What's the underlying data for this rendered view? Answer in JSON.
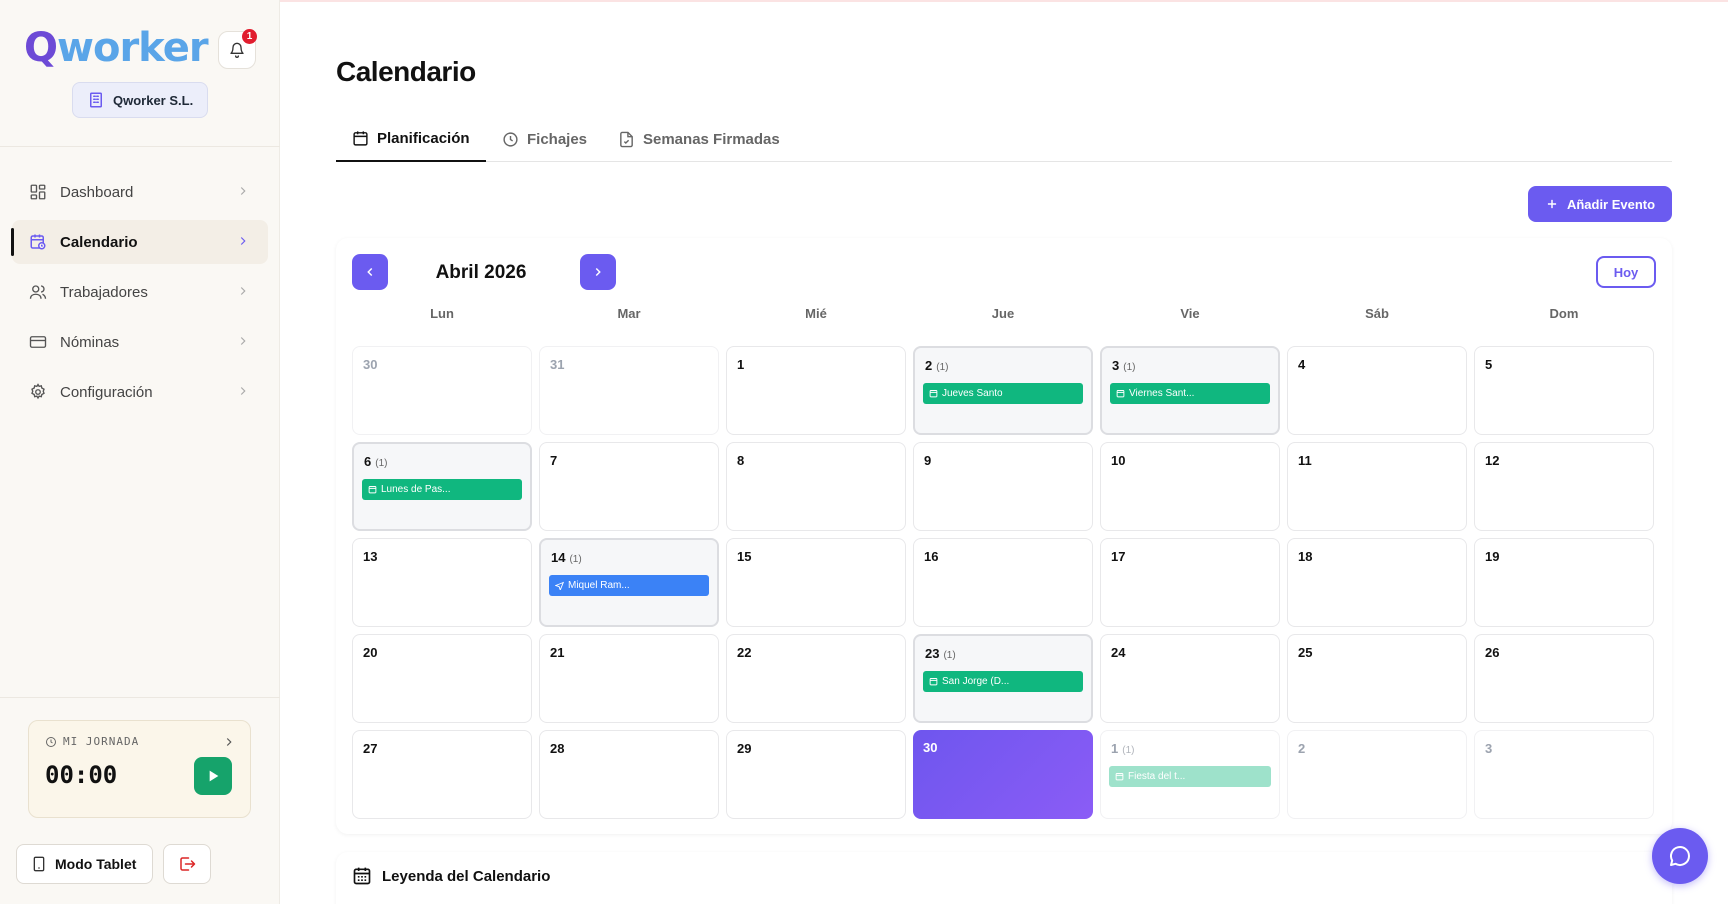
{
  "app": {
    "logo_q": "Q",
    "logo_rest": "worker",
    "notifications_count": "1",
    "company": "Qworker S.L."
  },
  "sidebar": {
    "items": [
      {
        "label": "Dashboard",
        "icon": "dashboard-icon",
        "active": false
      },
      {
        "label": "Calendario",
        "icon": "calendar-clock-icon",
        "active": true
      },
      {
        "label": "Trabajadores",
        "icon": "users-icon",
        "active": false
      },
      {
        "label": "Nóminas",
        "icon": "credit-card-icon",
        "active": false
      },
      {
        "label": "Configuración",
        "icon": "gear-icon",
        "active": false
      }
    ],
    "jornada_label": "MI JORNADA",
    "jornada_time": "00:00",
    "tablet_label": "Modo Tablet"
  },
  "page": {
    "title": "Calendario",
    "tabs": [
      {
        "label": "Planificación",
        "icon": "calendar-icon",
        "active": true
      },
      {
        "label": "Fichajes",
        "icon": "clock-icon",
        "active": false
      },
      {
        "label": "Semanas Firmadas",
        "icon": "file-check-icon",
        "active": false
      }
    ],
    "add_event_label": "Añadir Evento"
  },
  "calendar": {
    "month_label": "Abril 2026",
    "today_label": "Hoy",
    "weekdays": [
      "Lun",
      "Mar",
      "Mié",
      "Jue",
      "Vie",
      "Sáb",
      "Dom"
    ],
    "days": [
      {
        "num": "30",
        "other": true
      },
      {
        "num": "31",
        "other": true
      },
      {
        "num": "1"
      },
      {
        "num": "2",
        "count": "(1)",
        "event": {
          "label": "Jueves Santo",
          "type": "green"
        }
      },
      {
        "num": "3",
        "count": "(1)",
        "event": {
          "label": "Viernes Sant...",
          "type": "green"
        }
      },
      {
        "num": "4"
      },
      {
        "num": "5"
      },
      {
        "num": "6",
        "count": "(1)",
        "event": {
          "label": "Lunes de Pas...",
          "type": "green"
        }
      },
      {
        "num": "7"
      },
      {
        "num": "8"
      },
      {
        "num": "9"
      },
      {
        "num": "10"
      },
      {
        "num": "11"
      },
      {
        "num": "12"
      },
      {
        "num": "13"
      },
      {
        "num": "14",
        "count": "(1)",
        "event": {
          "label": "Miquel Ram...",
          "type": "blue"
        }
      },
      {
        "num": "15"
      },
      {
        "num": "16"
      },
      {
        "num": "17"
      },
      {
        "num": "18"
      },
      {
        "num": "19"
      },
      {
        "num": "20"
      },
      {
        "num": "21"
      },
      {
        "num": "22"
      },
      {
        "num": "23",
        "count": "(1)",
        "event": {
          "label": "San Jorge (D...",
          "type": "green"
        }
      },
      {
        "num": "24"
      },
      {
        "num": "25"
      },
      {
        "num": "26"
      },
      {
        "num": "27"
      },
      {
        "num": "28"
      },
      {
        "num": "29"
      },
      {
        "num": "30",
        "today": true
      },
      {
        "num": "1",
        "other": true,
        "count": "(1)",
        "event": {
          "label": "Fiesta del t...",
          "type": "green"
        }
      },
      {
        "num": "2",
        "other": true
      },
      {
        "num": "3",
        "other": true
      }
    ]
  },
  "legend": {
    "title": "Leyenda del Calendario"
  },
  "colors": {
    "accent": "#6b5bf0",
    "holiday": "#10b77f",
    "absence": "#3b82f6"
  }
}
